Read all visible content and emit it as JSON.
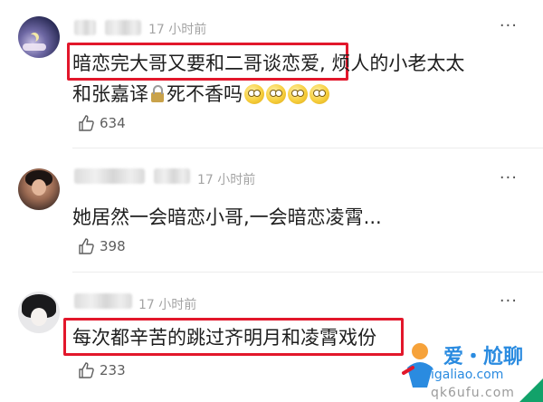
{
  "comments": [
    {
      "time": "17 小时前",
      "more": "···",
      "highlight": "暗恋完大哥又要和二哥谈恋爱,",
      "line1_rest": "  烦人的小老太太",
      "line2_a": "和张嘉译",
      "line2_b": "死不香吗",
      "likes": "634"
    },
    {
      "time": "17 小时前",
      "more": "···",
      "text": "她居然一会暗恋小哥,一会暗恋凌霄...",
      "likes": "398"
    },
    {
      "time": "17 小时前",
      "more": "···",
      "highlight": "每次都辛苦的跳过齐明月和凌霄戏份",
      "likes": "233"
    }
  ],
  "watermark": {
    "title": "爱・尬聊",
    "url": "igaliao.com",
    "url2": "qk6ufu.com"
  },
  "icons": {
    "like": "thumb-up-icon",
    "more": "more-dots-icon"
  }
}
